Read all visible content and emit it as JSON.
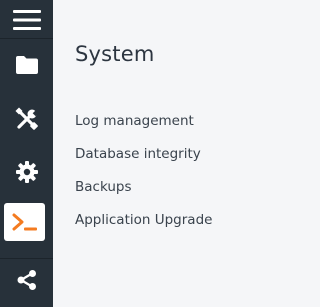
{
  "sidebar": {
    "items": [
      {
        "icon": "hamburger-menu-icon",
        "active": false
      },
      {
        "icon": "folder-icon",
        "active": false
      },
      {
        "icon": "wrench-screwdriver-icon",
        "active": false
      },
      {
        "icon": "gear-icon",
        "active": false
      },
      {
        "icon": "terminal-prompt-icon",
        "active": true
      },
      {
        "icon": "share-icon",
        "active": false
      }
    ],
    "colors": {
      "background": "#27313a",
      "icon": "#ffffff",
      "active_background": "#ffffff",
      "active_icon": "#f47b20"
    }
  },
  "main": {
    "title": "System",
    "menu": [
      {
        "label": "Log management"
      },
      {
        "label": "Database integrity"
      },
      {
        "label": "Backups"
      },
      {
        "label": "Application Upgrade"
      }
    ]
  }
}
